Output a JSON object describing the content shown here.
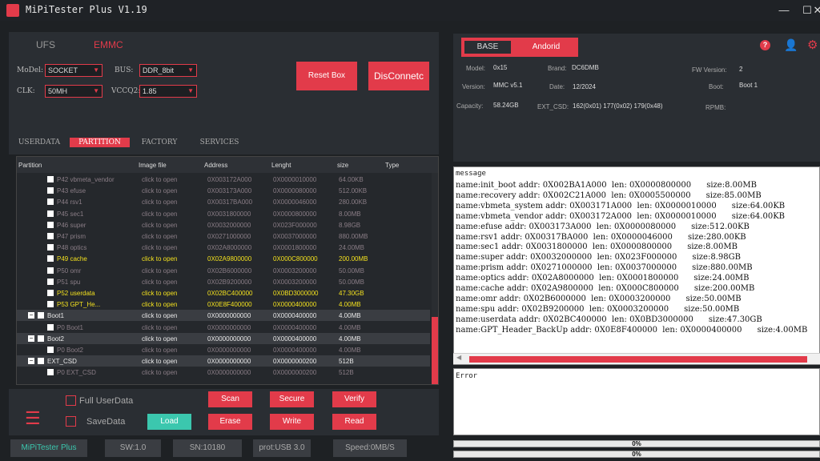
{
  "window": {
    "title": "MiPiTester Plus V1.19",
    "minimize": "—",
    "maximize": "☐",
    "close": "✕"
  },
  "left_tabs": {
    "ufs": "UFS",
    "emmc": "EMMC"
  },
  "config": {
    "model_label": "MoDel:",
    "model_value": "SOCKET",
    "bus_label": "BUS:",
    "bus_value": "DDR_8bit",
    "clk_label": "CLK:",
    "clk_value": "50MH",
    "vccq2_label": "VCCQ2:",
    "vccq2_value": "1.85"
  },
  "buttons": {
    "reset": "Reset Box",
    "disconnect": "DisConnetc"
  },
  "sub_tabs": [
    "USERDATA",
    "PARTITION",
    "FACTORY",
    "SERVICES"
  ],
  "grid": {
    "headers": [
      "Partition",
      "Image file",
      "Address",
      "Lenght",
      "size",
      "Type"
    ],
    "rows": [
      {
        "name": "P42 vbmeta_vendor",
        "image": "click to open",
        "address": "0X003172A000",
        "length": "0X0000010000",
        "size": "64.00KB",
        "indent": 1,
        "style": "normal"
      },
      {
        "name": "P43 efuse",
        "image": "click to open",
        "address": "0X003173A000",
        "length": "0X0000080000",
        "size": "512.00KB",
        "indent": 1,
        "style": "normal"
      },
      {
        "name": "P44 rsv1",
        "image": "click to open",
        "address": "0X00317BA000",
        "length": "0X0000046000",
        "size": "280.00KB",
        "indent": 1,
        "style": "normal"
      },
      {
        "name": "P45 sec1",
        "image": "click to open",
        "address": "0X0031800000",
        "length": "0X0000800000",
        "size": "8.00MB",
        "indent": 1,
        "style": "normal"
      },
      {
        "name": "P46 super",
        "image": "click to open",
        "address": "0X0032000000",
        "length": "0X023F000000",
        "size": "8.98GB",
        "indent": 1,
        "style": "normal"
      },
      {
        "name": "P47 prism",
        "image": "click to open",
        "address": "0X0271000000",
        "length": "0X0037000000",
        "size": "880.00MB",
        "indent": 1,
        "style": "normal"
      },
      {
        "name": "P48 optics",
        "image": "click to open",
        "address": "0X02A8000000",
        "length": "0X0001800000",
        "size": "24.00MB",
        "indent": 1,
        "style": "normal"
      },
      {
        "name": "P49 cache",
        "image": "click to open",
        "address": "0X02A9800000",
        "length": "0X000C800000",
        "size": "200.00MB",
        "indent": 1,
        "style": "yellow"
      },
      {
        "name": "P50 omr",
        "image": "click to open",
        "address": "0X02B6000000",
        "length": "0X0003200000",
        "size": "50.00MB",
        "indent": 1,
        "style": "normal"
      },
      {
        "name": "P51 spu",
        "image": "click to open",
        "address": "0X02B9200000",
        "length": "0X0003200000",
        "size": "50.00MB",
        "indent": 1,
        "style": "normal"
      },
      {
        "name": "P52 userdata",
        "image": "click to open",
        "address": "0X02BC400000",
        "length": "0X0BD3000000",
        "size": "47.30GB",
        "indent": 1,
        "style": "yellow"
      },
      {
        "name": "P53 GPT_He...",
        "image": "click to open",
        "address": "0X0E8F400000",
        "length": "0X0000400000",
        "size": "4.00MB",
        "indent": 1,
        "style": "yellow"
      },
      {
        "name": "Boot1",
        "image": "click to open",
        "address": "0X0000000000",
        "length": "0X0000400000",
        "size": "4.00MB",
        "indent": 0,
        "style": "group"
      },
      {
        "name": "P0 Boot1",
        "image": "click to open",
        "address": "0X0000000000",
        "length": "0X0000400000",
        "size": "4.00MB",
        "indent": 1,
        "style": "normal"
      },
      {
        "name": "Boot2",
        "image": "click to open",
        "address": "0X0000000000",
        "length": "0X0000400000",
        "size": "4.00MB",
        "indent": 0,
        "style": "group"
      },
      {
        "name": "P0 Boot2",
        "image": "click to open",
        "address": "0X0000000000",
        "length": "0X0000400000",
        "size": "4.00MB",
        "indent": 1,
        "style": "normal"
      },
      {
        "name": "EXT_CSD",
        "image": "click to open",
        "address": "0X0000000000",
        "length": "0X0000000200",
        "size": "512B",
        "indent": 0,
        "style": "group"
      },
      {
        "name": "P0 EXT_CSD",
        "image": "click to open",
        "address": "0X0000000000",
        "length": "0X0000000200",
        "size": "512B",
        "indent": 1,
        "style": "normal"
      }
    ]
  },
  "bottom": {
    "full_userdata": "Full UserData",
    "save_data": "SaveData",
    "load": "Load",
    "scan": "Scan",
    "secure": "Secure",
    "verify": "Verify",
    "erase": "Erase",
    "write": "Write",
    "read": "Read",
    "menu_icon": "☰"
  },
  "status": {
    "app": "MiPiTester Plus",
    "sw": "SW:1.0",
    "sn": "SN:10180",
    "prot": "prot:USB 3.0",
    "speed": "Speed:0MB/S"
  },
  "right_tabs": {
    "base": "BASE",
    "android": "Andorid"
  },
  "info": {
    "model_label": "Model:",
    "model_value": "0x15",
    "brand_label": "Brand:",
    "brand_value": "DC6DMB",
    "fw_label": "FW Version:",
    "fw_value": "2",
    "version_label": "Version:",
    "version_value": "MMC v5.1",
    "date_label": "Date:",
    "date_value": "12/2024",
    "boot_label": "Boot:",
    "boot_value": "Boot 1",
    "capacity_label": "Capacity:",
    "capacity_value": "58.24GB",
    "extcsd_label": "EXT_CSD:",
    "extcsd_value": "162(0x01) 177(0x02) 179(0x48)",
    "rpmb_label": "RPMB:"
  },
  "message": {
    "title": "message",
    "lines": [
      "name:init_boot addr: 0X002BA1A000  len: 0X0000800000      size:8.00MB",
      "name:recovery addr: 0X002C21A000  len: 0X0005500000      size:85.00MB",
      "name:vbmeta_system addr: 0X003171A000  len: 0X0000010000      size:64.00KB",
      "name:vbmeta_vendor addr: 0X003172A000  len: 0X0000010000      size:64.00KB",
      "name:efuse addr: 0X003173A000  len: 0X0000080000      size:512.00KB",
      "name:rsv1 addr: 0X00317BA000  len: 0X0000046000      size:280.00KB",
      "name:sec1 addr: 0X0031800000  len: 0X0000800000      size:8.00MB",
      "name:super addr: 0X0032000000  len: 0X023F000000      size:8.98GB",
      "name:prism addr: 0X0271000000  len: 0X0037000000      size:880.00MB",
      "name:optics addr: 0X02A8000000  len: 0X0001800000      size:24.00MB",
      "name:cache addr: 0X02A9800000  len: 0X000C800000      size:200.00MB",
      "name:omr addr: 0X02B6000000  len: 0X0003200000      size:50.00MB",
      "name:spu addr: 0X02B9200000  len: 0X0003200000      size:50.00MB",
      "name:userdata addr: 0X02BC400000  len: 0X0BD3000000      size:47.30GB",
      "name:GPT_Header_BackUp addr: 0X0E8F400000  len: 0X0000400000      size:4.00MB"
    ]
  },
  "error": {
    "title": "Error"
  },
  "progress": {
    "bar1": "0%",
    "bar2": "0%"
  },
  "colors": {
    "accent": "#e23b4a",
    "yellow": "#f2e01e",
    "muted": "#8a7d86"
  }
}
